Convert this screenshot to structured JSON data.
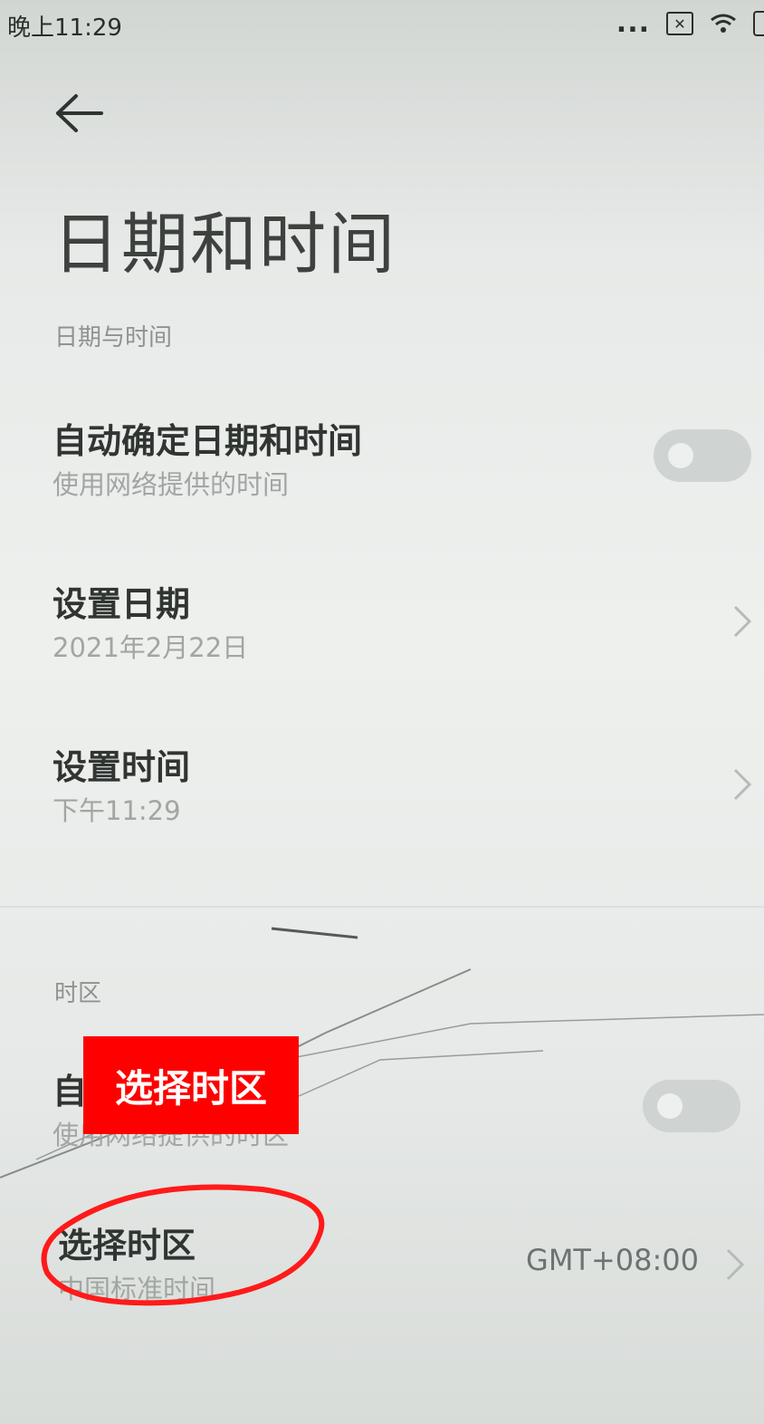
{
  "status_bar": {
    "time": "晚上11:29",
    "more_indicator": "...",
    "sim_icon": "sim-disabled-icon",
    "wifi_icon": "wifi-icon",
    "battery_icon": "battery-icon"
  },
  "header": {
    "back_icon": "back-arrow-icon",
    "title": "日期和时间"
  },
  "section_datetime": {
    "label": "日期与时间",
    "auto_datetime": {
      "title": "自动确定日期和时间",
      "subtitle": "使用网络提供的时间",
      "toggle_on": false
    },
    "set_date": {
      "title": "设置日期",
      "value": "2021年2月22日"
    },
    "set_time": {
      "title": "设置时间",
      "value": "下午11:29"
    }
  },
  "section_timezone": {
    "label": "时区",
    "auto_timezone": {
      "title": "自",
      "subtitle": "使用网络提供的时区",
      "toggle_on": false
    },
    "select_timezone": {
      "title": "选择时区",
      "subtitle": "中国标准时间",
      "value": "GMT+08:00"
    }
  },
  "annotation": {
    "callout_text": "选择时区",
    "callout_color": "#ff0000"
  }
}
